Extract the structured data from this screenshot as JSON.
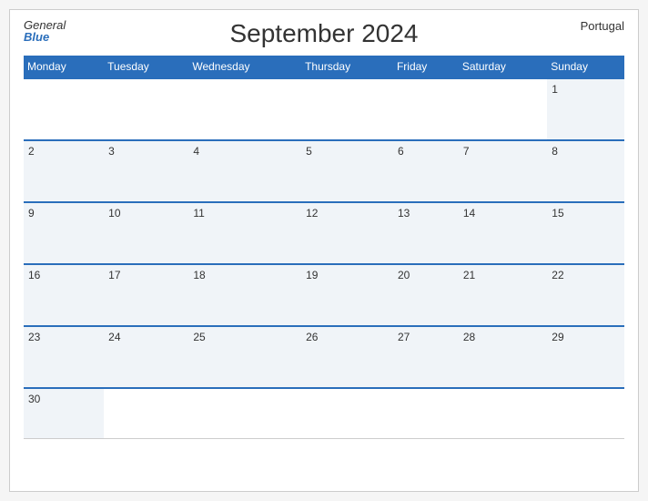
{
  "header": {
    "title": "September 2024",
    "country": "Portugal",
    "logo_general": "General",
    "logo_blue": "Blue"
  },
  "days_of_week": [
    "Monday",
    "Tuesday",
    "Wednesday",
    "Thursday",
    "Friday",
    "Saturday",
    "Sunday"
  ],
  "weeks": [
    [
      "",
      "",
      "",
      "",
      "",
      "",
      "1"
    ],
    [
      "2",
      "3",
      "4",
      "5",
      "6",
      "7",
      "8"
    ],
    [
      "9",
      "10",
      "11",
      "12",
      "13",
      "14",
      "15"
    ],
    [
      "16",
      "17",
      "18",
      "19",
      "20",
      "21",
      "22"
    ],
    [
      "23",
      "24",
      "25",
      "26",
      "27",
      "28",
      "29"
    ],
    [
      "30",
      "",
      "",
      "",
      "",
      "",
      ""
    ]
  ]
}
